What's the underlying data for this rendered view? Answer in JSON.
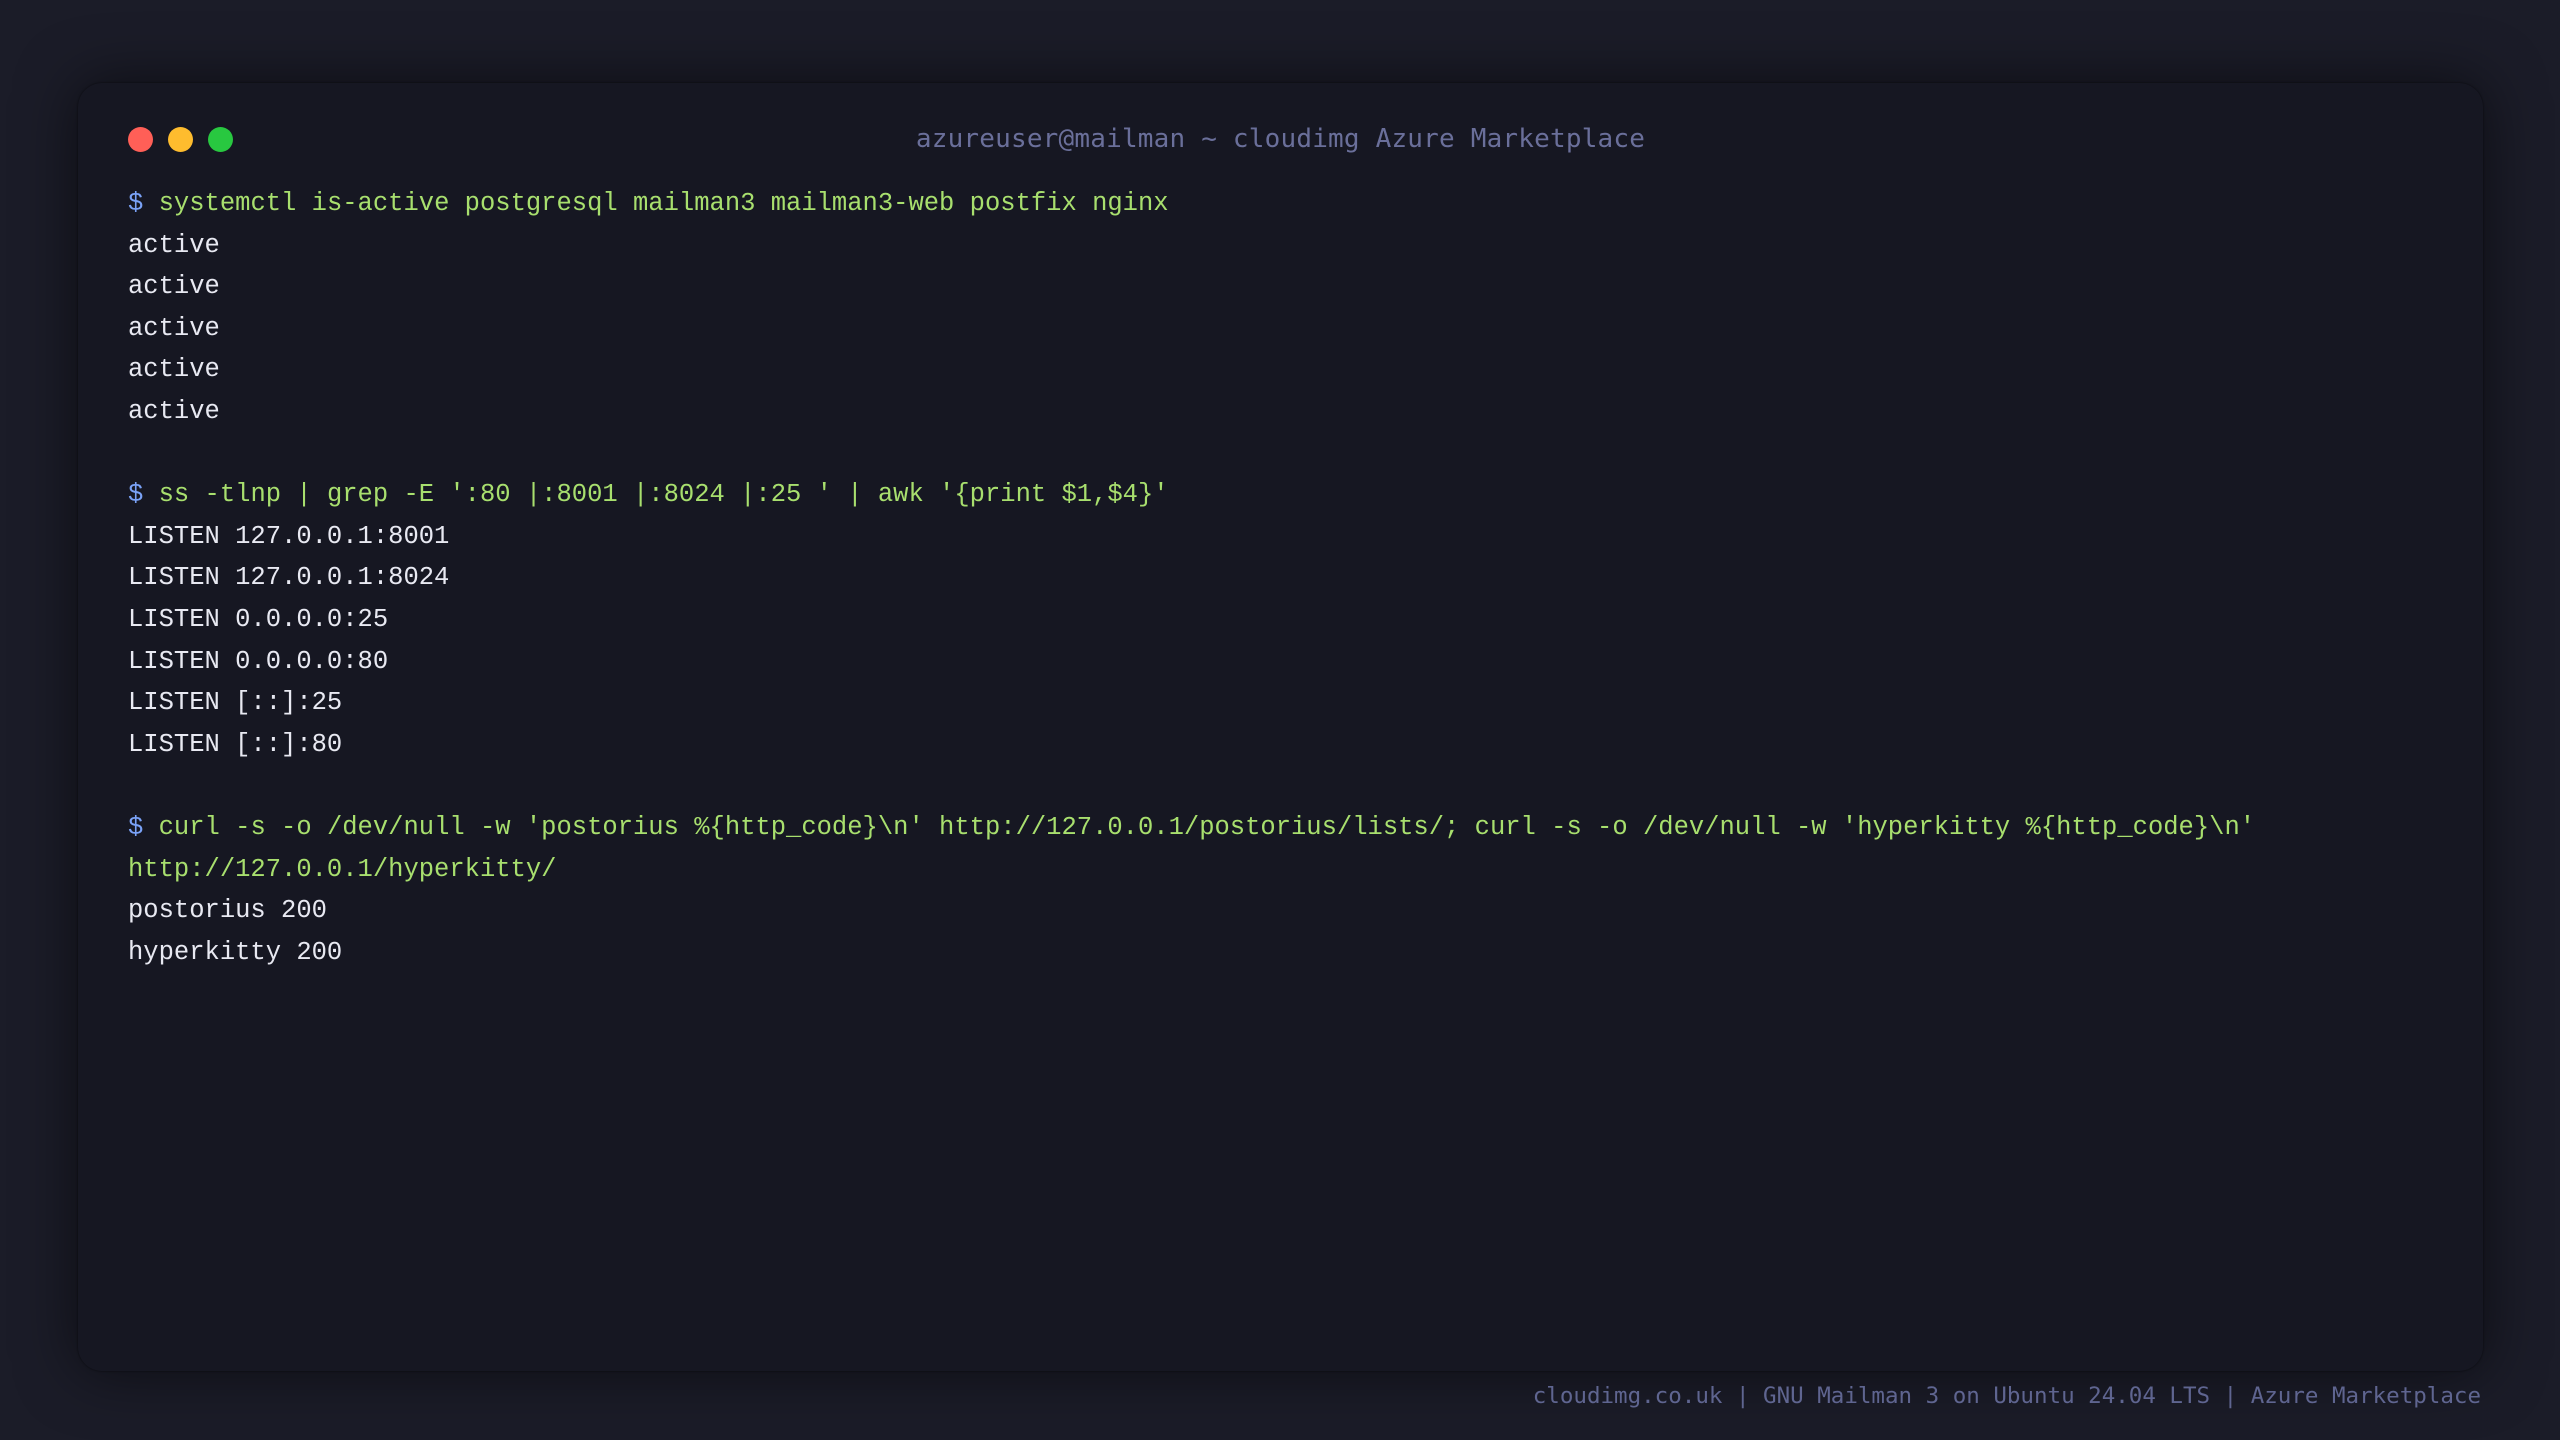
{
  "window": {
    "title": "azureuser@mailman ~ cloudimg Azure Marketplace",
    "controls": {
      "close_color": "#ff5f57",
      "minimize_color": "#febc2e",
      "maximize_color": "#28c840"
    }
  },
  "terminal": {
    "prompt_symbol": "$",
    "blocks": [
      {
        "command": "systemctl is-active postgresql mailman3 mailman3-web postfix nginx",
        "output": [
          "active",
          "active",
          "active",
          "active",
          "active"
        ]
      },
      {
        "command": "ss -tlnp | grep -E ':80 |:8001 |:8024 |:25 ' | awk '{print $1,$4}'",
        "output": [
          "LISTEN 127.0.0.1:8001",
          "LISTEN 127.0.0.1:8024",
          "LISTEN 0.0.0.0:25",
          "LISTEN 0.0.0.0:80",
          "LISTEN [::]:25",
          "LISTEN [::]:80"
        ]
      },
      {
        "command": "curl -s -o /dev/null -w 'postorius %{http_code}\\n' http://127.0.0.1/postorius/lists/; curl -s -o /dev/null -w 'hyperkitty %{http_code}\\n'",
        "command_wrap": "http://127.0.0.1/hyperkitty/",
        "output": [
          "postorius 200",
          "hyperkitty 200"
        ]
      }
    ]
  },
  "footer": {
    "text": "cloudimg.co.uk | GNU Mailman 3 on Ubuntu 24.04 LTS | Azure Marketplace"
  },
  "colors": {
    "background": "#1b1c28",
    "window_bg": "#161722",
    "prompt": "#7aa2f7",
    "command": "#a8df6e",
    "output": "#e8e9f2",
    "title": "#6a6f9a"
  }
}
